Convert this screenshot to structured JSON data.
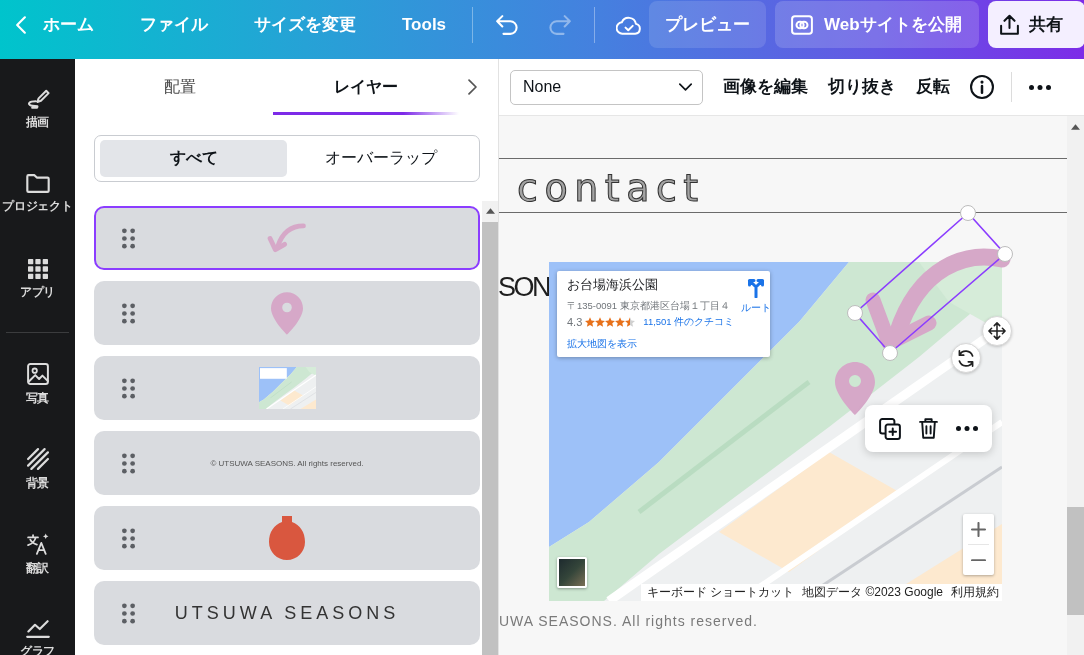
{
  "top_bar": {
    "home": "ホーム",
    "menu": [
      {
        "label": "ファイル"
      },
      {
        "label": "サイズを変更"
      },
      {
        "label": "Tools"
      }
    ],
    "history": [
      {
        "kind": "undo",
        "disabled": false
      },
      {
        "kind": "redo",
        "disabled": true
      }
    ],
    "preview": "プレビュー",
    "publish": "Webサイトを公開",
    "share": "共有"
  },
  "sidebar": {
    "groups": [
      [
        {
          "kind": "draw",
          "label": "描画"
        },
        {
          "kind": "projects",
          "label": "プロジェクト"
        },
        {
          "kind": "apps",
          "label": "アプリ"
        }
      ],
      [
        {
          "kind": "photos",
          "label": "写真"
        },
        {
          "kind": "backgrounds",
          "label": "背景"
        },
        {
          "kind": "translate",
          "label": "翻訳"
        },
        {
          "kind": "charts",
          "label": "グラフ"
        }
      ]
    ]
  },
  "panel": {
    "tabs": [
      {
        "label": "配置",
        "selected": false
      },
      {
        "label": "レイヤー",
        "selected": true
      }
    ],
    "filters": [
      {
        "label": "すべて",
        "selected": true
      },
      {
        "label": "オーバーラップ",
        "selected": false
      }
    ],
    "layers": [
      {
        "kind": "arrow",
        "selected": true
      },
      {
        "kind": "pin",
        "selected": false
      },
      {
        "kind": "map",
        "selected": false
      },
      {
        "kind": "caption",
        "text": "© UTSUWA SEASONS. All rights reserved.",
        "selected": false
      },
      {
        "kind": "vase",
        "selected": false
      },
      {
        "kind": "wordmark",
        "text": "UTSUWA SEASONS",
        "selected": false
      }
    ]
  },
  "toolbar": {
    "dropdown": "None",
    "actions": [
      "画像を編集",
      "切り抜き",
      "反転"
    ]
  },
  "canvas": {
    "heading": "contact",
    "wordmark": "SON",
    "map": {
      "info_card": {
        "title": "お台場海浜公園",
        "address": "〒135-0091 東京都港区台場１丁目４",
        "rating": "4.3",
        "stars": 4.5,
        "reviews": "11,501 件のクチコミ",
        "larger_map": "拡大地図を表示",
        "route": "ルート"
      },
      "attribution": [
        "キーボード ショートカット",
        "地図データ ©2023 Google",
        "利用規約"
      ]
    },
    "footer": "UWA SEASONS. All rights reserved."
  }
}
